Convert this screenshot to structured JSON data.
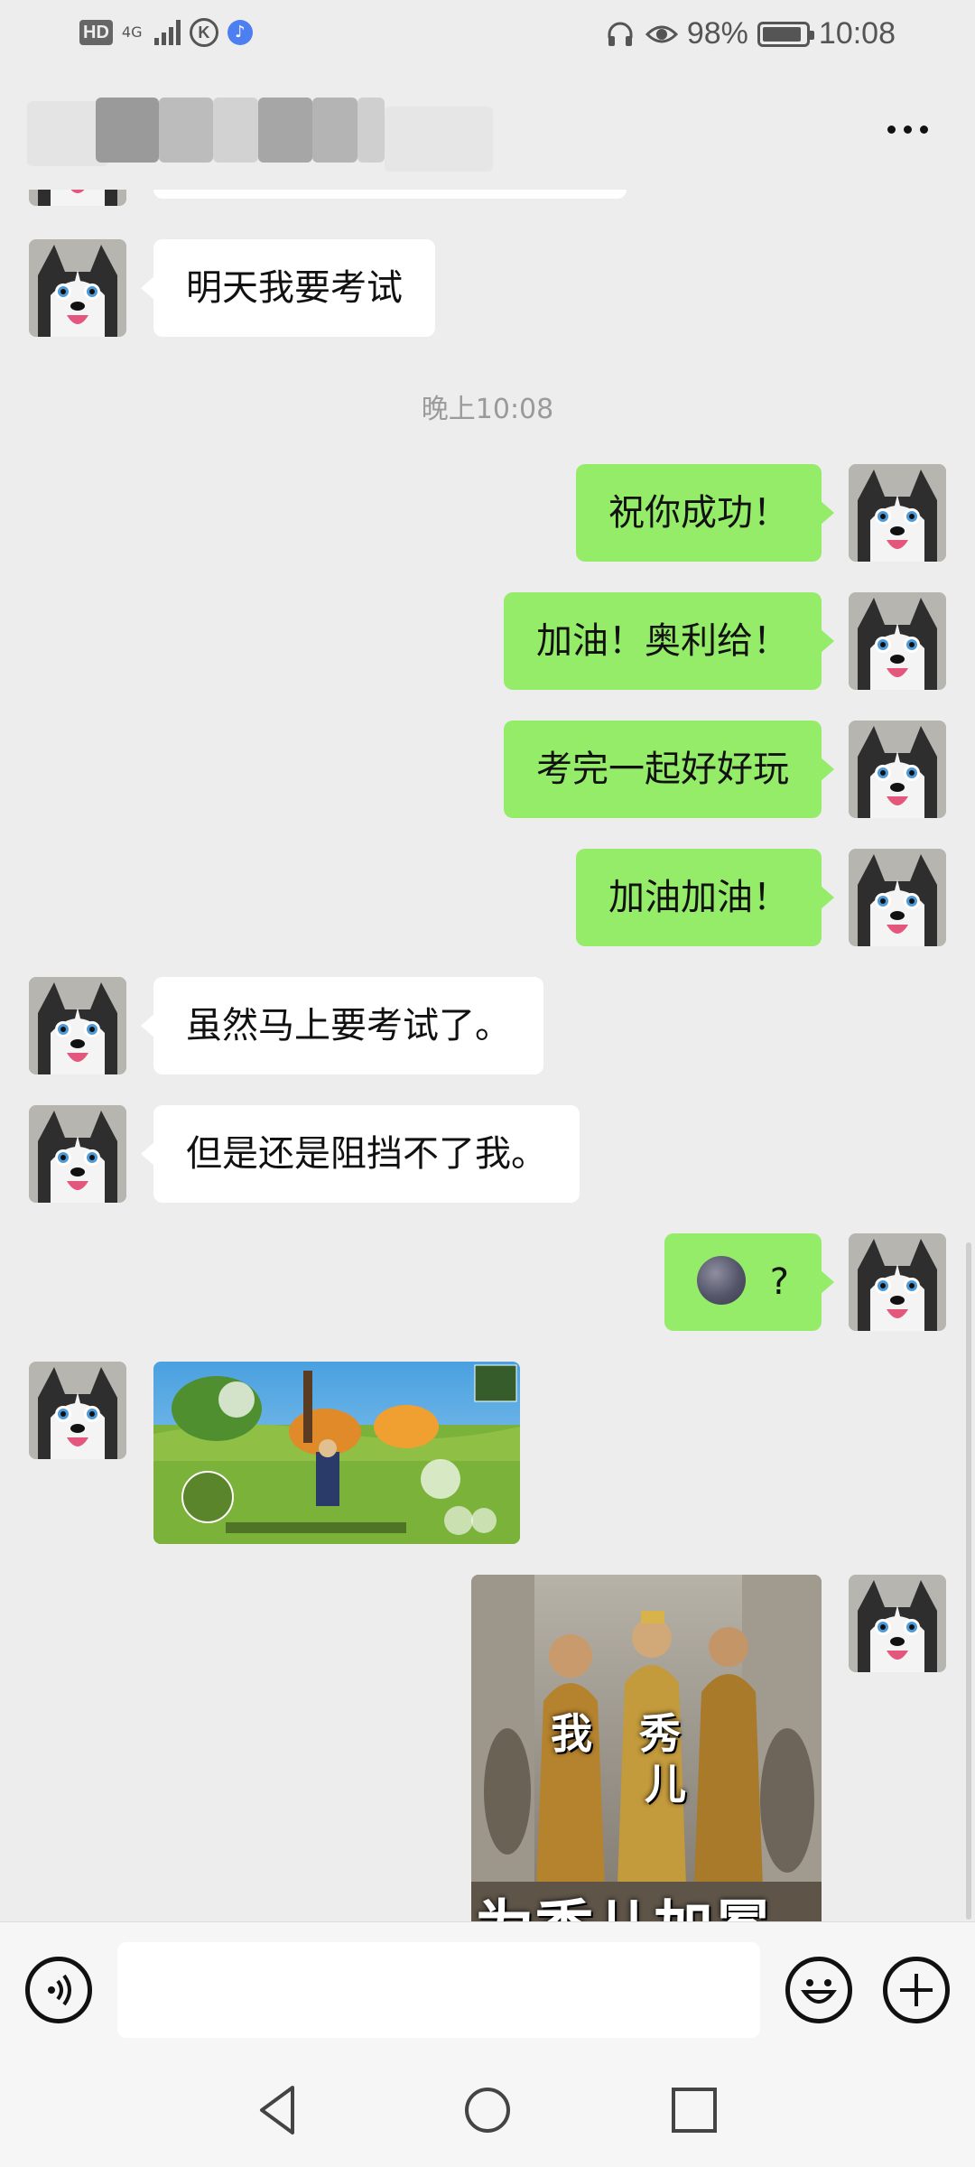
{
  "status_bar": {
    "hd": "HD",
    "network": "4G",
    "k_icon": "K",
    "battery_percent": "98%",
    "battery_level": 0.98,
    "time": "10:08"
  },
  "header": {
    "more_icon": "more-dots-icon"
  },
  "messages": [
    {
      "side": "in",
      "type": "text",
      "text": ""
    },
    {
      "side": "in",
      "type": "text",
      "text": "明天我要考试"
    },
    {
      "type": "time",
      "text": "晚上10:08"
    },
    {
      "side": "out",
      "type": "text",
      "text": "祝你成功！"
    },
    {
      "side": "out",
      "type": "text",
      "text": "加油！奥利给！"
    },
    {
      "side": "out",
      "type": "text",
      "text": "考完一起好好玩"
    },
    {
      "side": "out",
      "type": "text",
      "text": "加油加油！"
    },
    {
      "side": "in",
      "type": "text",
      "text": "虽然马上要考试了。"
    },
    {
      "side": "in",
      "type": "text",
      "text": "但是还是阻挡不了我。"
    },
    {
      "side": "out",
      "type": "emoji",
      "emoji": "new-moon-face-icon",
      "text": "?"
    },
    {
      "side": "in",
      "type": "image",
      "image": "game-screenshot"
    },
    {
      "side": "out",
      "type": "image",
      "image": "meme-sticker",
      "caption_chars": [
        "我",
        "秀",
        "儿"
      ],
      "caption": "为秀儿加冕"
    }
  ],
  "input_bar": {
    "voice_icon": "voice-icon",
    "input_value": "",
    "emoji_icon": "emoji-icon",
    "plus_icon": "plus-icon"
  },
  "system_nav": {
    "back": "back-triangle-icon",
    "home": "home-circle-icon",
    "recents": "recents-square-icon"
  }
}
